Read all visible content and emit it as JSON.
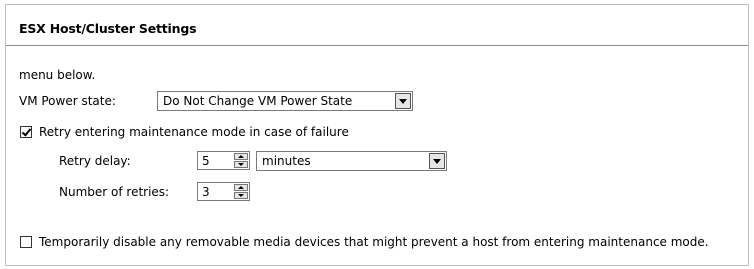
{
  "panel": {
    "title": "ESX Host/Cluster Settings"
  },
  "intro_text": "menu below.",
  "power_state": {
    "label": "VM Power state:",
    "selected": "Do Not Change VM Power State"
  },
  "retry": {
    "checked": true,
    "label": "Retry entering maintenance mode in case of failure",
    "delay_label": "Retry delay:",
    "delay_value": "5",
    "delay_unit": "minutes",
    "count_label": "Number of retries:",
    "count_value": "3"
  },
  "removable_media": {
    "checked": false,
    "label": "Temporarily disable any removable media devices that might prevent a host from entering maintenance mode."
  },
  "icons": [
    "dropdown-arrow-icon",
    "spinner-up-icon",
    "spinner-down-icon",
    "checkmark-icon"
  ]
}
